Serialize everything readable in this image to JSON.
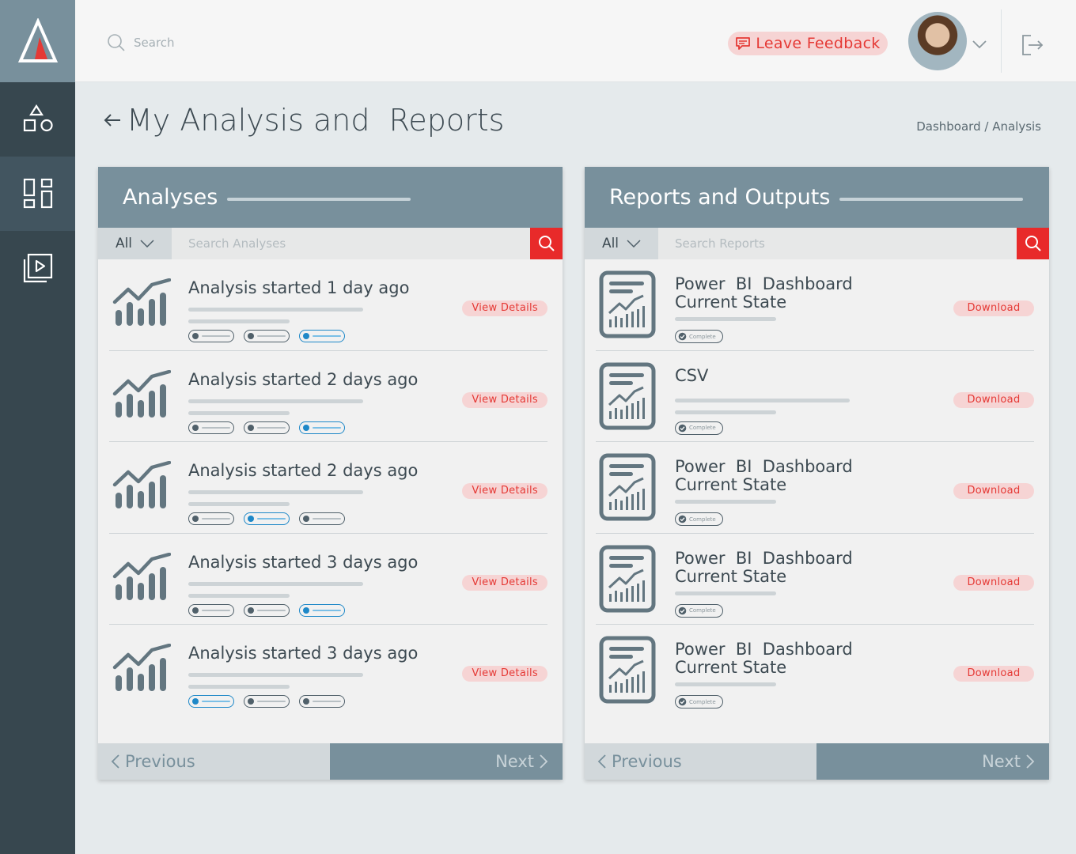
{
  "header": {
    "search_placeholder": "Search",
    "feedback_label": "Leave Feedback"
  },
  "page": {
    "title": "My Analysis and  Reports",
    "breadcrumb": "Dashboard / Analysis"
  },
  "analyses": {
    "title": "Analyses",
    "filter": "All",
    "search_placeholder": "Search Analyses",
    "action_label": "View Details",
    "items": [
      {
        "title": "Analysis started 1 day ago",
        "active_step": 3
      },
      {
        "title": "Analysis started 2 days ago",
        "active_step": 3
      },
      {
        "title": "Analysis started 2 days ago",
        "active_step": 2
      },
      {
        "title": "Analysis started 3 days ago",
        "active_step": 3
      },
      {
        "title": "Analysis started 3 days ago",
        "active_step": 1
      }
    ],
    "prev_label": "Previous",
    "next_label": "Next"
  },
  "reports": {
    "title": "Reports and Outputs",
    "filter": "All",
    "search_placeholder": "Search Reports",
    "action_label": "Download",
    "badge_label": "Complete",
    "items": [
      {
        "title_line1": "Power  BI  Dashboard",
        "title_line2": "Current State"
      },
      {
        "title_line1": "CSV",
        "title_line2": ""
      },
      {
        "title_line1": "Power  BI  Dashboard",
        "title_line2": "Current State"
      },
      {
        "title_line1": "Power  BI  Dashboard",
        "title_line2": "Current State"
      },
      {
        "title_line1": "Power  BI  Dashboard",
        "title_line2": "Current State"
      }
    ],
    "prev_label": "Previous",
    "next_label": "Next"
  },
  "colors": {
    "accent": "#e53935",
    "sidebar": "#37474f",
    "panel_header": "#78909c",
    "active_step": "#1e88c8"
  }
}
